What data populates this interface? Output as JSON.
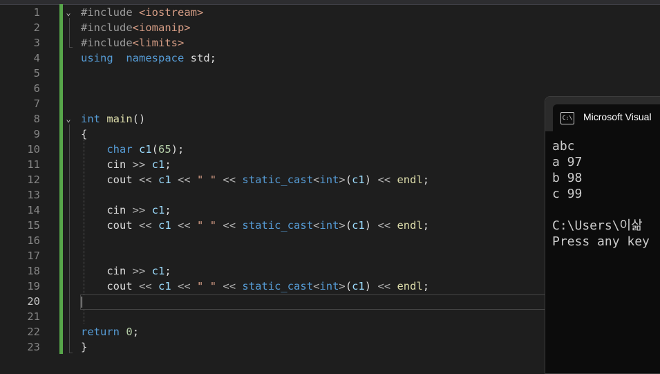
{
  "editor": {
    "lines": [
      {
        "num": "1",
        "fold": "⌄",
        "tokens": [
          [
            "pp",
            "#include "
          ],
          [
            "inc",
            "<iostream>"
          ]
        ]
      },
      {
        "num": "2",
        "fold": "",
        "tokens": [
          [
            "pp",
            "#include"
          ],
          [
            "inc",
            "<iomanip>"
          ]
        ]
      },
      {
        "num": "3",
        "fold": "",
        "tokens": [
          [
            "pp",
            "#include"
          ],
          [
            "inc",
            "<limits>"
          ]
        ]
      },
      {
        "num": "4",
        "fold": "",
        "tokens": [
          [
            "kw",
            "using"
          ],
          [
            "",
            "  "
          ],
          [
            "kw",
            "namespace"
          ],
          [
            "",
            " std;"
          ]
        ]
      },
      {
        "num": "5",
        "fold": "",
        "tokens": []
      },
      {
        "num": "6",
        "fold": "",
        "tokens": []
      },
      {
        "num": "7",
        "fold": "",
        "tokens": []
      },
      {
        "num": "8",
        "fold": "⌄",
        "tokens": [
          [
            "kw",
            "int"
          ],
          [
            "",
            " "
          ],
          [
            "fn",
            "main"
          ],
          [
            "",
            "()"
          ]
        ]
      },
      {
        "num": "9",
        "fold": "",
        "tokens": [
          [
            "",
            "{"
          ]
        ]
      },
      {
        "num": "10",
        "fold": "",
        "tokens": [
          [
            "",
            "    "
          ],
          [
            "kw",
            "char"
          ],
          [
            "",
            " "
          ],
          [
            "var",
            "c1"
          ],
          [
            "",
            "("
          ],
          [
            "num",
            "65"
          ],
          [
            "",
            ");"
          ]
        ]
      },
      {
        "num": "11",
        "fold": "",
        "tokens": [
          [
            "",
            "    cin "
          ],
          [
            "op",
            ">>"
          ],
          [
            "",
            " "
          ],
          [
            "var",
            "c1"
          ],
          [
            "",
            ";"
          ]
        ]
      },
      {
        "num": "12",
        "fold": "",
        "tokens": [
          [
            "",
            "    cout "
          ],
          [
            "op",
            "<<"
          ],
          [
            "",
            " "
          ],
          [
            "var",
            "c1"
          ],
          [
            "",
            " "
          ],
          [
            "op",
            "<<"
          ],
          [
            "",
            " "
          ],
          [
            "str",
            "\" \""
          ],
          [
            "",
            " "
          ],
          [
            "op",
            "<<"
          ],
          [
            "",
            " "
          ],
          [
            "kw",
            "static_cast"
          ],
          [
            "op",
            "<"
          ],
          [
            "kw",
            "int"
          ],
          [
            "op",
            ">"
          ],
          [
            "",
            "("
          ],
          [
            "var",
            "c1"
          ],
          [
            "",
            ") "
          ],
          [
            "op",
            "<<"
          ],
          [
            "",
            " "
          ],
          [
            "fn",
            "endl"
          ],
          [
            "",
            ";"
          ]
        ]
      },
      {
        "num": "13",
        "fold": "",
        "tokens": []
      },
      {
        "num": "14",
        "fold": "",
        "tokens": [
          [
            "",
            "    cin "
          ],
          [
            "op",
            ">>"
          ],
          [
            "",
            " "
          ],
          [
            "var",
            "c1"
          ],
          [
            "",
            ";"
          ]
        ]
      },
      {
        "num": "15",
        "fold": "",
        "tokens": [
          [
            "",
            "    cout "
          ],
          [
            "op",
            "<<"
          ],
          [
            "",
            " "
          ],
          [
            "var",
            "c1"
          ],
          [
            "",
            " "
          ],
          [
            "op",
            "<<"
          ],
          [
            "",
            " "
          ],
          [
            "str",
            "\" \""
          ],
          [
            "",
            " "
          ],
          [
            "op",
            "<<"
          ],
          [
            "",
            " "
          ],
          [
            "kw",
            "static_cast"
          ],
          [
            "op",
            "<"
          ],
          [
            "kw",
            "int"
          ],
          [
            "op",
            ">"
          ],
          [
            "",
            "("
          ],
          [
            "var",
            "c1"
          ],
          [
            "",
            ") "
          ],
          [
            "op",
            "<<"
          ],
          [
            "",
            " "
          ],
          [
            "fn",
            "endl"
          ],
          [
            "",
            ";"
          ]
        ]
      },
      {
        "num": "16",
        "fold": "",
        "tokens": []
      },
      {
        "num": "17",
        "fold": "",
        "tokens": []
      },
      {
        "num": "18",
        "fold": "",
        "tokens": [
          [
            "",
            "    cin "
          ],
          [
            "op",
            ">>"
          ],
          [
            "",
            " "
          ],
          [
            "var",
            "c1"
          ],
          [
            "",
            ";"
          ]
        ]
      },
      {
        "num": "19",
        "fold": "",
        "tokens": [
          [
            "",
            "    cout "
          ],
          [
            "op",
            "<<"
          ],
          [
            "",
            " "
          ],
          [
            "var",
            "c1"
          ],
          [
            "",
            " "
          ],
          [
            "op",
            "<<"
          ],
          [
            "",
            " "
          ],
          [
            "str",
            "\" \""
          ],
          [
            "",
            " "
          ],
          [
            "op",
            "<<"
          ],
          [
            "",
            " "
          ],
          [
            "kw",
            "static_cast"
          ],
          [
            "op",
            "<"
          ],
          [
            "kw",
            "int"
          ],
          [
            "op",
            ">"
          ],
          [
            "",
            "("
          ],
          [
            "var",
            "c1"
          ],
          [
            "",
            ") "
          ],
          [
            "op",
            "<<"
          ],
          [
            "",
            " "
          ],
          [
            "fn",
            "endl"
          ],
          [
            "",
            ";"
          ]
        ]
      },
      {
        "num": "20",
        "fold": "",
        "tokens": [],
        "current": true
      },
      {
        "num": "21",
        "fold": "",
        "tokens": []
      },
      {
        "num": "22",
        "fold": "",
        "tokens": [
          [
            "kw",
            "return"
          ],
          [
            "",
            " "
          ],
          [
            "num",
            "0"
          ],
          [
            "",
            ";"
          ]
        ]
      },
      {
        "num": "23",
        "fold": "",
        "tokens": [
          [
            "",
            "}"
          ]
        ]
      }
    ]
  },
  "console": {
    "title": "Microsoft Visual",
    "icon": "console-icon",
    "icon_glyph": "C:\\",
    "lines": [
      "abc",
      "a 97",
      "b 98",
      "c 99",
      "",
      "C:\\Users\\이삶",
      "Press any key"
    ]
  }
}
